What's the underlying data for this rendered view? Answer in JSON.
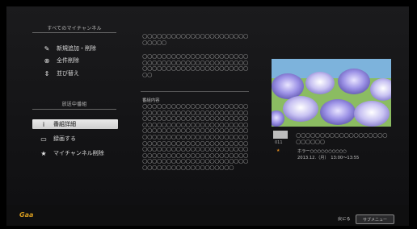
{
  "left_menu": {
    "my_channels_title": "すべてのマイチャンネル",
    "items": [
      {
        "icon": "edit-check-icon",
        "label": "新規追加・削除"
      },
      {
        "icon": "delete-all-icon",
        "label": "全件削除"
      },
      {
        "icon": "sort-icon",
        "label": "並び替え"
      }
    ],
    "on_air_title": "放送中番組",
    "on_air_items": [
      {
        "icon": "info-icon",
        "label": "番組詳細",
        "selected": true
      },
      {
        "icon": "record-icon",
        "label": "録画する",
        "selected": false
      },
      {
        "icon": "star-icon",
        "label": "マイチャンネル削除",
        "selected": false
      }
    ]
  },
  "middle": {
    "title_block": "○○○○○○○○○○○○○○○○○○○○○○○○○○○",
    "desc_block": "○○○○○○○○○○○○○○○○○○○○○○○○○○○○○○○○○○○○○○○○○○○○○○○○○○○○○○○○○○○○○○○○○○○○",
    "content_label": "番組内容",
    "content_block": "○○○○○○○○○○○○○○○○○○○○○○○○○○○○○○○○○○○○○○○○○○○○○○○○○○○○○○○○○○○○○○○○○○○○○○○○○○○○○○○○○○○○○○○○○○○○○○○○○○○○○○○○○○○○○○○○○○○○○○○○○○○○○○○○○○○○○○○○○○○○○○○○○○○○○○○○○○○○○○○○○○○○○○○○○○○○○○○○○○○○○○○○○○○○○○○○○○○○○○○○○○○○○○○○○○○○○○○○○○○○○○○○○○○○○○○○○○○○○○○"
  },
  "right_panel": {
    "channel_number": "011",
    "program_title": "○○○○○○○○○○○○○○○○○○○○○○○○○",
    "genre_line": "ホラー○○○○○○○○○○",
    "datetime": "2013.12.（月）　13:00〜13:55"
  },
  "bottom_bar": {
    "logo_text": "Gaa",
    "back_text": "戻にる",
    "submenu_label": "サブメニュー"
  },
  "colors": {
    "selected_bg": "#e0e0e0",
    "accent_orange": "#e08a1e"
  }
}
